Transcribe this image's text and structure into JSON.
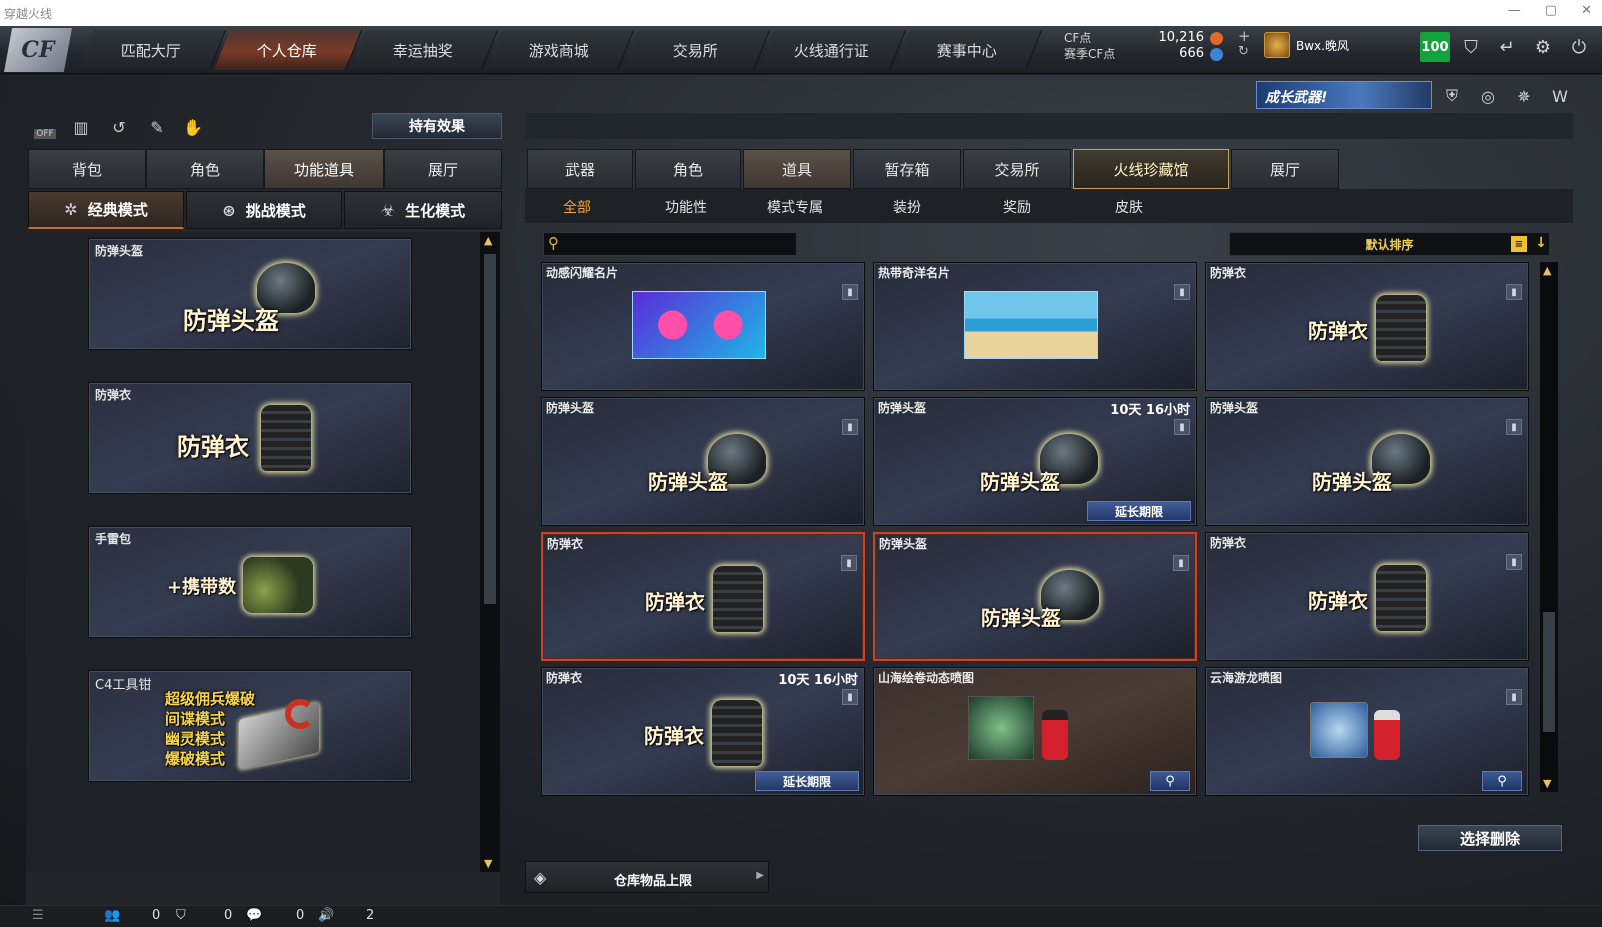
{
  "window": {
    "title": "穿越火线",
    "controls": [
      "—",
      "▢",
      "✕"
    ]
  },
  "nav": {
    "logo": "CF",
    "tabs": [
      "匹配大厅",
      "个人仓库",
      "幸运抽奖",
      "游戏商城",
      "交易所",
      "火线通行证",
      "赛事中心"
    ],
    "active": 1
  },
  "currency": {
    "cf_label": "CF点",
    "season_label": "赛季CF点",
    "cf_value": "10,216",
    "season_value": "666",
    "plus": "+",
    "refresh": "↻"
  },
  "user": {
    "name": "Bwx.晚风",
    "level": "100"
  },
  "banner": {
    "text": "成长武器!"
  },
  "left": {
    "off_label": "OFF",
    "hold_effect": "持有效果",
    "tabs": [
      "背包",
      "角色",
      "功能道具",
      "展厅"
    ],
    "active_tab": 2,
    "modes": [
      "经典模式",
      "挑战模式",
      "生化模式"
    ],
    "active_mode": 0,
    "items": [
      {
        "label": "防弹头盔",
        "title": "防弹头盔"
      },
      {
        "label": "防弹衣",
        "title": "防弹衣"
      },
      {
        "label": "手雷包",
        "title": "+携带数"
      },
      {
        "label": "C4工具钳",
        "lines": [
          "超级佣兵爆破",
          "间谍模式",
          "幽灵模式",
          "爆破模式"
        ]
      }
    ]
  },
  "right": {
    "tabs": [
      "武器",
      "角色",
      "道具",
      "暂存箱",
      "交易所",
      "火线珍藏馆",
      "展厅"
    ],
    "active_tab": 2,
    "subtabs": [
      "全部",
      "功能性",
      "模式专属",
      "装扮",
      "奖励",
      "皮肤"
    ],
    "active_sub": 0,
    "sort_label": "默认排序",
    "cards": [
      {
        "label": "动感闪耀名片",
        "kind": "namecard1"
      },
      {
        "label": "热带奇洋名片",
        "kind": "namecard2"
      },
      {
        "label": "防弹衣",
        "title": "防弹衣",
        "kind": "vest"
      },
      {
        "label": "防弹头盔",
        "title": "防弹头盔",
        "kind": "helmet"
      },
      {
        "label": "防弹头盔",
        "title": "防弹头盔",
        "kind": "helmet",
        "time": "10天 16小时",
        "extend": "延长期限"
      },
      {
        "label": "防弹头盔",
        "title": "防弹头盔",
        "kind": "helmet"
      },
      {
        "label": "防弹衣",
        "title": "防弹衣",
        "kind": "vest",
        "selected": true
      },
      {
        "label": "防弹头盔",
        "title": "防弹头盔",
        "kind": "helmet",
        "selected": true
      },
      {
        "label": "防弹衣",
        "title": "防弹衣",
        "kind": "vest"
      },
      {
        "label": "防弹衣",
        "title": "防弹衣",
        "kind": "vest",
        "time": "10天 16小时",
        "extend": "延长期限"
      },
      {
        "label": "山海绘卷动态喷图",
        "kind": "spray1"
      },
      {
        "label": "云海游龙喷图",
        "kind": "spray2"
      }
    ],
    "delete_button": "选择删除",
    "capacity_label": "仓库物品上限"
  },
  "statusbar": {
    "a": "0",
    "b": "0",
    "c": "0",
    "d": "2"
  }
}
